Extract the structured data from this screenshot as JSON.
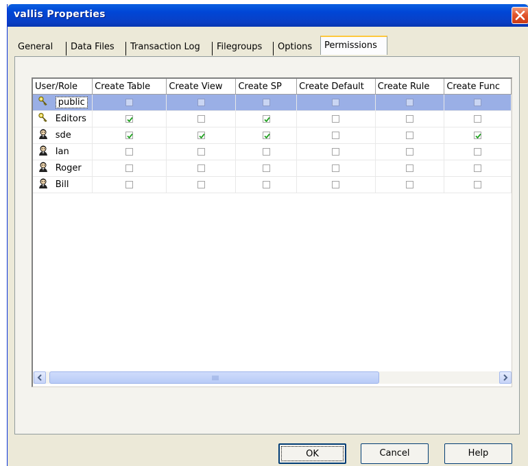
{
  "window": {
    "title": "vallis Properties"
  },
  "tabs": [
    {
      "label": "General",
      "active": false
    },
    {
      "label": "Data Files",
      "active": false
    },
    {
      "label": "Transaction Log",
      "active": false
    },
    {
      "label": "Filegroups",
      "active": false
    },
    {
      "label": "Options",
      "active": false
    },
    {
      "label": "Permissions",
      "active": true
    }
  ],
  "grid": {
    "columns": [
      "User/Role",
      "Create Table",
      "Create View",
      "Create SP",
      "Create Default",
      "Create Rule",
      "Create Func"
    ],
    "rows": [
      {
        "name": "public",
        "icon": "role-key-icon",
        "selected": true,
        "perms": [
          false,
          false,
          false,
          false,
          false,
          false
        ]
      },
      {
        "name": "Editors",
        "icon": "role-key-icon",
        "selected": false,
        "perms": [
          true,
          false,
          true,
          false,
          false,
          false
        ]
      },
      {
        "name": "sde",
        "icon": "user-icon",
        "selected": false,
        "perms": [
          true,
          true,
          true,
          false,
          false,
          true
        ]
      },
      {
        "name": "Ian",
        "icon": "user-icon",
        "selected": false,
        "perms": [
          false,
          false,
          false,
          false,
          false,
          false
        ]
      },
      {
        "name": "Roger",
        "icon": "user-icon",
        "selected": false,
        "perms": [
          false,
          false,
          false,
          false,
          false,
          false
        ]
      },
      {
        "name": "Bill",
        "icon": "user-icon",
        "selected": false,
        "perms": [
          false,
          false,
          false,
          false,
          false,
          false
        ]
      }
    ]
  },
  "buttons": {
    "ok": "OK",
    "cancel": "Cancel",
    "help": "Help"
  },
  "colors": {
    "titlebar": "#0a3fc4",
    "selection": "#9aafe6",
    "dialog": "#ece9d8",
    "check": "#21a121"
  }
}
